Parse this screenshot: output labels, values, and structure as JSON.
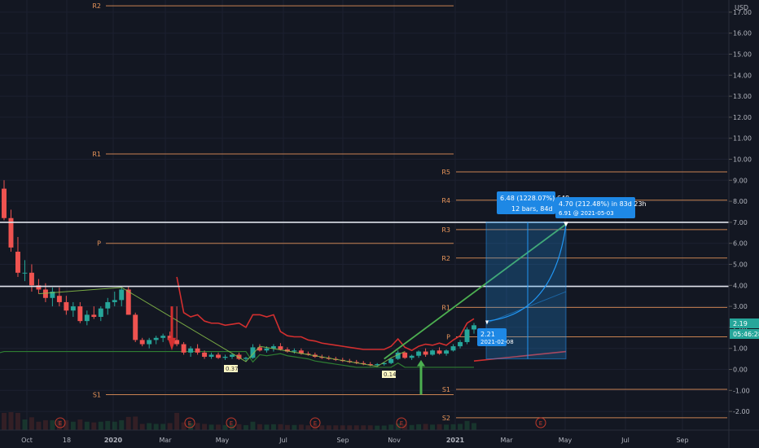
{
  "chart_data": {
    "type": "candlestick",
    "currency": "USD",
    "y_axis": {
      "ticks": [
        "17.00",
        "16.00",
        "15.00",
        "14.00",
        "13.00",
        "12.00",
        "11.00",
        "10.00",
        "9.00",
        "8.00",
        "7.00",
        "6.00",
        "5.00",
        "4.00",
        "3.00",
        "2.00",
        "1.00",
        "0.00",
        "-1.00",
        "-2.00"
      ],
      "range": [
        -2.6,
        17.5
      ]
    },
    "x_axis": {
      "ticks": [
        "Oct",
        "18",
        "2020",
        "Mar",
        "May",
        "Jul",
        "Sep",
        "Nov",
        "2021",
        "Mar",
        "May",
        "Jul",
        "Sep"
      ]
    },
    "pivots_left": {
      "levels": [
        {
          "label": "R2",
          "value": 17.3
        },
        {
          "label": "R1",
          "value": 10.25
        },
        {
          "label": "P",
          "value": 6.0
        },
        {
          "label": "S1",
          "value": -1.2
        }
      ]
    },
    "pivots_right": {
      "levels": [
        {
          "label": "R5",
          "value": 9.4
        },
        {
          "label": "R4",
          "value": 8.05
        },
        {
          "label": "R3",
          "value": 6.65
        },
        {
          "label": "R2",
          "value": 5.3
        },
        {
          "label": "R1",
          "value": 2.95
        },
        {
          "label": "P",
          "value": 1.55
        },
        {
          "label": "S1",
          "value": -0.95
        },
        {
          "label": "S2",
          "value": -2.3
        }
      ]
    },
    "horizontal_lines": [
      7.0,
      3.95
    ],
    "candles": [
      {
        "o": 8.6,
        "h": 9.0,
        "l": 7.1,
        "c": 7.2
      },
      {
        "o": 7.2,
        "h": 7.6,
        "l": 5.6,
        "c": 5.8
      },
      {
        "o": 5.6,
        "h": 6.3,
        "l": 4.4,
        "c": 4.6
      },
      {
        "o": 4.6,
        "h": 5.2,
        "l": 4.2,
        "c": 4.6
      },
      {
        "o": 4.6,
        "h": 5.0,
        "l": 3.7,
        "c": 4.0
      },
      {
        "o": 4.0,
        "h": 4.3,
        "l": 3.6,
        "c": 3.8
      },
      {
        "o": 3.8,
        "h": 4.1,
        "l": 3.2,
        "c": 3.4
      },
      {
        "o": 3.4,
        "h": 3.9,
        "l": 3.0,
        "c": 3.7
      },
      {
        "o": 3.5,
        "h": 3.9,
        "l": 3.0,
        "c": 3.2
      },
      {
        "o": 3.2,
        "h": 3.5,
        "l": 2.6,
        "c": 2.8
      },
      {
        "o": 2.8,
        "h": 3.2,
        "l": 2.5,
        "c": 3.0
      },
      {
        "o": 3.0,
        "h": 3.2,
        "l": 2.2,
        "c": 2.3
      },
      {
        "o": 2.3,
        "h": 2.8,
        "l": 2.1,
        "c": 2.6
      },
      {
        "o": 2.6,
        "h": 3.0,
        "l": 2.4,
        "c": 2.5
      },
      {
        "o": 2.5,
        "h": 3.0,
        "l": 2.3,
        "c": 2.9
      },
      {
        "o": 2.9,
        "h": 3.4,
        "l": 2.6,
        "c": 3.2
      },
      {
        "o": 3.2,
        "h": 3.7,
        "l": 3.0,
        "c": 3.3
      },
      {
        "o": 3.3,
        "h": 3.9,
        "l": 3.0,
        "c": 3.8
      },
      {
        "o": 3.8,
        "h": 3.95,
        "l": 2.6,
        "c": 2.6
      },
      {
        "o": 2.6,
        "h": 2.7,
        "l": 1.3,
        "c": 1.4
      },
      {
        "o": 1.4,
        "h": 1.5,
        "l": 1.1,
        "c": 1.2
      },
      {
        "o": 1.2,
        "h": 1.5,
        "l": 1.0,
        "c": 1.4
      },
      {
        "o": 1.4,
        "h": 1.6,
        "l": 1.2,
        "c": 1.5
      },
      {
        "o": 1.5,
        "h": 1.7,
        "l": 1.3,
        "c": 1.6
      },
      {
        "o": 1.6,
        "h": 1.8,
        "l": 1.3,
        "c": 1.4
      },
      {
        "o": 1.4,
        "h": 3.0,
        "l": 1.1,
        "c": 1.2
      },
      {
        "o": 1.2,
        "h": 1.3,
        "l": 0.7,
        "c": 0.8
      },
      {
        "o": 0.8,
        "h": 1.1,
        "l": 0.6,
        "c": 1.0
      },
      {
        "o": 1.0,
        "h": 1.2,
        "l": 0.7,
        "c": 0.8
      },
      {
        "o": 0.8,
        "h": 0.9,
        "l": 0.5,
        "c": 0.6
      },
      {
        "o": 0.6,
        "h": 0.8,
        "l": 0.5,
        "c": 0.7
      },
      {
        "o": 0.7,
        "h": 0.8,
        "l": 0.5,
        "c": 0.55
      },
      {
        "o": 0.55,
        "h": 0.7,
        "l": 0.45,
        "c": 0.6
      },
      {
        "o": 0.6,
        "h": 0.75,
        "l": 0.5,
        "c": 0.7
      },
      {
        "o": 0.7,
        "h": 0.8,
        "l": 0.45,
        "c": 0.5
      },
      {
        "o": 0.5,
        "h": 0.6,
        "l": 0.37,
        "c": 0.55
      },
      {
        "o": 0.55,
        "h": 1.2,
        "l": 0.5,
        "c": 1.05
      },
      {
        "o": 1.05,
        "h": 1.2,
        "l": 0.85,
        "c": 0.9
      },
      {
        "o": 0.9,
        "h": 1.1,
        "l": 0.8,
        "c": 1.0
      },
      {
        "o": 1.0,
        "h": 1.2,
        "l": 0.85,
        "c": 1.1
      },
      {
        "o": 1.1,
        "h": 1.25,
        "l": 0.9,
        "c": 0.95
      },
      {
        "o": 0.95,
        "h": 1.05,
        "l": 0.8,
        "c": 0.85
      },
      {
        "o": 0.85,
        "h": 1.0,
        "l": 0.75,
        "c": 0.9
      },
      {
        "o": 0.9,
        "h": 1.0,
        "l": 0.7,
        "c": 0.75
      },
      {
        "o": 0.75,
        "h": 0.85,
        "l": 0.65,
        "c": 0.7
      },
      {
        "o": 0.7,
        "h": 0.8,
        "l": 0.55,
        "c": 0.6
      },
      {
        "o": 0.6,
        "h": 0.7,
        "l": 0.5,
        "c": 0.55
      },
      {
        "o": 0.55,
        "h": 0.65,
        "l": 0.45,
        "c": 0.5
      },
      {
        "o": 0.5,
        "h": 0.6,
        "l": 0.4,
        "c": 0.45
      },
      {
        "o": 0.45,
        "h": 0.55,
        "l": 0.35,
        "c": 0.4
      },
      {
        "o": 0.4,
        "h": 0.5,
        "l": 0.3,
        "c": 0.35
      },
      {
        "o": 0.35,
        "h": 0.45,
        "l": 0.25,
        "c": 0.3
      },
      {
        "o": 0.3,
        "h": 0.4,
        "l": 0.2,
        "c": 0.25
      },
      {
        "o": 0.25,
        "h": 0.35,
        "l": 0.15,
        "c": 0.2
      },
      {
        "o": 0.2,
        "h": 0.3,
        "l": 0.14,
        "c": 0.25
      },
      {
        "o": 0.25,
        "h": 0.35,
        "l": 0.18,
        "c": 0.3
      },
      {
        "o": 0.3,
        "h": 0.55,
        "l": 0.25,
        "c": 0.5
      },
      {
        "o": 0.5,
        "h": 0.9,
        "l": 0.45,
        "c": 0.8
      },
      {
        "o": 0.8,
        "h": 0.85,
        "l": 0.5,
        "c": 0.55
      },
      {
        "o": 0.55,
        "h": 0.7,
        "l": 0.45,
        "c": 0.65
      },
      {
        "o": 0.65,
        "h": 0.9,
        "l": 0.55,
        "c": 0.85
      },
      {
        "o": 0.85,
        "h": 1.0,
        "l": 0.6,
        "c": 0.7
      },
      {
        "o": 0.7,
        "h": 0.95,
        "l": 0.65,
        "c": 0.9
      },
      {
        "o": 0.9,
        "h": 1.05,
        "l": 0.7,
        "c": 0.75
      },
      {
        "o": 0.75,
        "h": 0.95,
        "l": 0.65,
        "c": 0.9
      },
      {
        "o": 0.9,
        "h": 1.2,
        "l": 0.85,
        "c": 1.1
      },
      {
        "o": 1.1,
        "h": 1.4,
        "l": 1.0,
        "c": 1.3
      },
      {
        "o": 1.3,
        "h": 2.0,
        "l": 1.2,
        "c": 1.9
      },
      {
        "o": 1.9,
        "h": 2.21,
        "l": 1.7,
        "c": 2.1
      }
    ],
    "annotations": [
      {
        "text": "0.37"
      },
      {
        "text": "0.14"
      },
      {
        "text": "2.21",
        "sub": "2021-02-08"
      }
    ],
    "measure_box": {
      "line1": "6.48 (1228.07%) 648",
      "line2": "12 bars, 84d"
    },
    "projection_box": {
      "line1": "4.70 (212.48%) in 83d 23h",
      "line2": "6.91 @ 2021-05-03"
    },
    "price_badges": [
      {
        "text": "2.19",
        "color": "#26a69a"
      },
      {
        "text": "05:46:28",
        "color": "#26a69a"
      }
    ],
    "event_markers": [
      "E",
      "E",
      "E",
      "E",
      "E",
      "E"
    ],
    "colors": {
      "up": "#26a69a",
      "down": "#ef5350",
      "pivot": "#e8955a",
      "trend_line": "#7cbb3a",
      "projection": "#2196f3",
      "red_band": "#d32f2f",
      "green_band": "#2e7d32"
    }
  }
}
